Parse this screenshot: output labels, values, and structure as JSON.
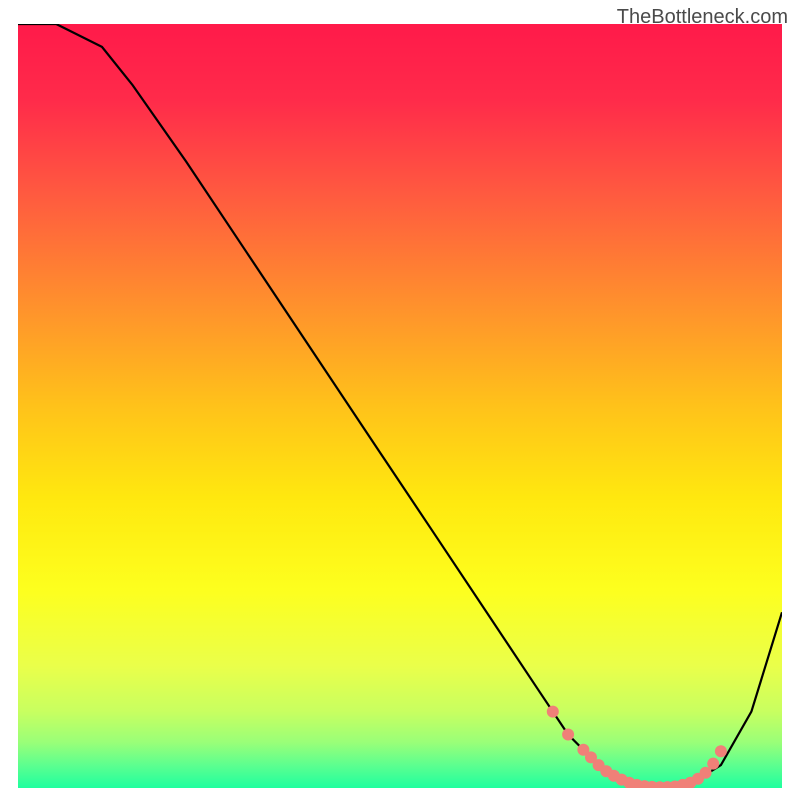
{
  "watermark": "TheBottleneck.com",
  "chart_data": {
    "type": "line",
    "title": "",
    "xlabel": "",
    "ylabel": "",
    "xlim": [
      0,
      100
    ],
    "ylim": [
      0,
      100
    ],
    "series": [
      {
        "name": "curve",
        "x": [
          0,
          5,
          11,
          15,
          22,
          30,
          38,
          46,
          54,
          62,
          68,
          72,
          76,
          80,
          84,
          88,
          92,
          96,
          100
        ],
        "y": [
          100,
          100,
          97,
          92,
          82,
          70,
          58,
          46,
          34,
          22,
          13,
          7,
          3,
          0.5,
          0,
          0.5,
          3,
          10,
          23
        ]
      }
    ],
    "markers": {
      "name": "highlight-points",
      "x": [
        70,
        72,
        74,
        75,
        76,
        77,
        78,
        79,
        80,
        81,
        82,
        83,
        84,
        85,
        86,
        87,
        88,
        89,
        90,
        91,
        92
      ],
      "y": [
        10,
        7,
        5,
        4,
        3,
        2.2,
        1.6,
        1.1,
        0.7,
        0.4,
        0.25,
        0.15,
        0.1,
        0.12,
        0.2,
        0.4,
        0.7,
        1.2,
        2,
        3.2,
        4.8
      ]
    },
    "gradient_stops": [
      {
        "pos": 0.0,
        "color": "#ff1a4a"
      },
      {
        "pos": 0.1,
        "color": "#ff2b4a"
      },
      {
        "pos": 0.22,
        "color": "#ff5940"
      },
      {
        "pos": 0.35,
        "color": "#ff8a2f"
      },
      {
        "pos": 0.5,
        "color": "#ffc21a"
      },
      {
        "pos": 0.62,
        "color": "#ffe80f"
      },
      {
        "pos": 0.74,
        "color": "#fdff1e"
      },
      {
        "pos": 0.84,
        "color": "#eaff4a"
      },
      {
        "pos": 0.9,
        "color": "#c8ff60"
      },
      {
        "pos": 0.94,
        "color": "#9aff78"
      },
      {
        "pos": 0.97,
        "color": "#5dff8f"
      },
      {
        "pos": 1.0,
        "color": "#1fff9f"
      }
    ]
  }
}
